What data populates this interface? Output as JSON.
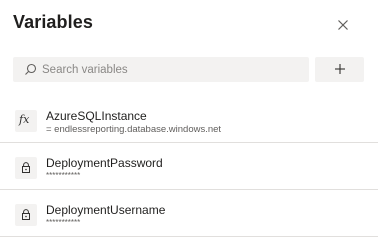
{
  "panel": {
    "title": "Variables",
    "close_icon": "close-icon"
  },
  "search": {
    "placeholder": "Search variables",
    "value": "",
    "icon": "search-icon"
  },
  "toolbar": {
    "add_icon": "plus-icon"
  },
  "variables": [
    {
      "name": "AzureSQLInstance",
      "value": "= endlessreporting.database.windows.net",
      "icon": "fx-icon",
      "secret": false
    },
    {
      "name": "DeploymentPassword",
      "value": "***********",
      "icon": "lock-icon",
      "secret": true
    },
    {
      "name": "DeploymentUsername",
      "value": "***********",
      "icon": "lock-icon",
      "secret": true
    }
  ]
}
